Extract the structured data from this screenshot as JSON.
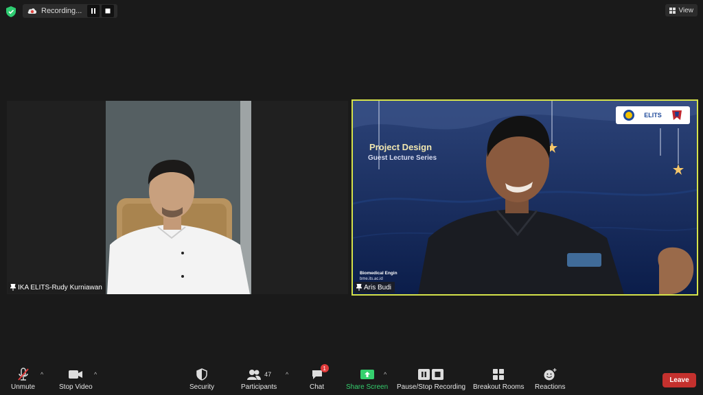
{
  "top": {
    "recording_label": "Recording...",
    "view_label": "View"
  },
  "participants": [
    {
      "name": "IKA ELITS-Rudy Kurniawan"
    },
    {
      "name": "Aris Budi"
    }
  ],
  "slide": {
    "title": "Project Design",
    "subtitle": "Guest Lecture Series",
    "footer_line1": "Biomedical Engin",
    "footer_line2": "bme.its.ac.id",
    "logo_text": "ELITS"
  },
  "toolbar": {
    "unmute": "Unmute",
    "stop_video": "Stop Video",
    "security": "Security",
    "participants": "Participants",
    "participants_count": "47",
    "chat": "Chat",
    "chat_badge": "1",
    "share_screen": "Share Screen",
    "pause_stop_recording": "Pause/Stop Recording",
    "breakout_rooms": "Breakout Rooms",
    "reactions": "Reactions",
    "leave": "Leave"
  },
  "colors": {
    "active_speaker_border": "#d6e34a",
    "share_green": "#35d06e",
    "leave_red": "#c4312e"
  }
}
